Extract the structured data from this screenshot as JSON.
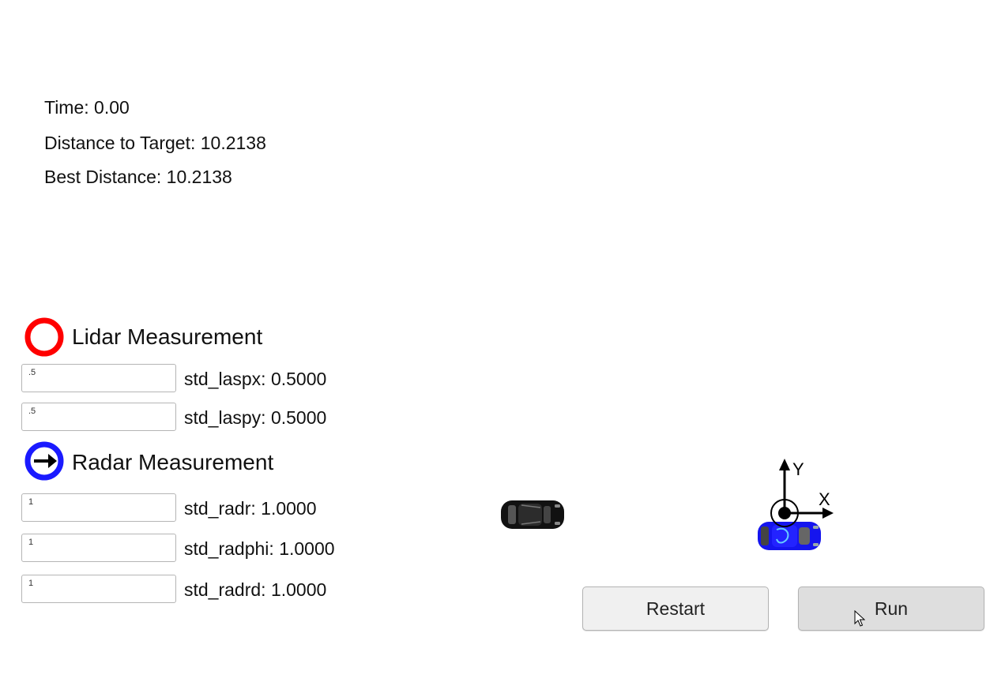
{
  "stats": {
    "time": "Time: 0.00",
    "distance": "Distance to Target: 10.2138",
    "best": "Best Distance: 10.2138"
  },
  "lidar": {
    "title": "Lidar Measurement",
    "icon": "red-ring-icon",
    "color": "#ff0000",
    "fields": [
      {
        "value": ".5",
        "label": "std_laspx: 0.5000"
      },
      {
        "value": ".5",
        "label": "std_laspy: 0.5000"
      }
    ]
  },
  "radar": {
    "title": "Radar Measurement",
    "icon": "blue-ring-arrow-icon",
    "color": "#1a1aff",
    "fields": [
      {
        "value": "1",
        "label": "std_radr: 1.0000"
      },
      {
        "value": "1",
        "label": "std_radphi: 1.0000"
      },
      {
        "value": "1",
        "label": "std_radrd: 1.0000"
      }
    ]
  },
  "scene": {
    "axis_x_label": "X",
    "axis_y_label": "Y",
    "target_car_color": "#111111",
    "ego_car_color": "#1515ee"
  },
  "buttons": {
    "restart": "Restart",
    "run": "Run"
  }
}
